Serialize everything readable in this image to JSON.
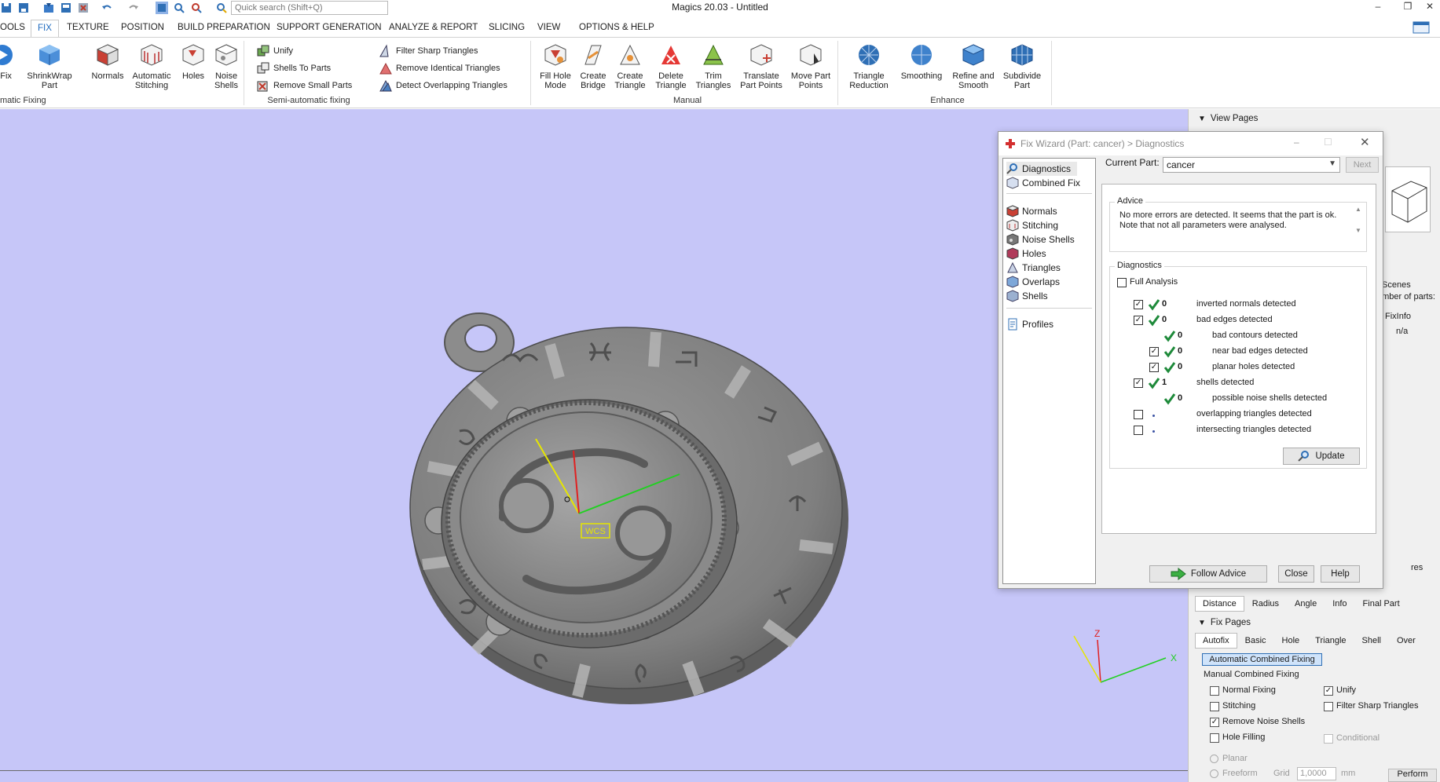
{
  "window": {
    "title": "Magics 20.03 - Untitled",
    "search_placeholder": "Quick search (Shift+Q)",
    "controls": [
      "–",
      "❐",
      "✕"
    ]
  },
  "menu_tabs": [
    "OOLS",
    "FIX",
    "TEXTURE",
    "POSITION",
    "BUILD PREPARATION",
    "SUPPORT GENERATION",
    "ANALYZE & REPORT",
    "SLICING",
    "VIEW",
    "OPTIONS & HELP"
  ],
  "ribbon": {
    "automatic_fixing": {
      "label": "matic Fixing",
      "buttons": [
        "toFix",
        "ShrinkWrap Part",
        "Normals",
        "Automatic Stitching",
        "Holes",
        "Noise Shells"
      ]
    },
    "semi_automatic_fixing": {
      "label": "Semi-automatic fixing",
      "items": [
        "Unify",
        "Shells To Parts",
        "Remove Small Parts",
        "Filter Sharp Triangles",
        "Remove Identical Triangles",
        "Detect Overlapping Triangles"
      ]
    },
    "manual": {
      "label": "Manual",
      "buttons": [
        "Fill Hole Mode",
        "Create Bridge",
        "Create Triangle",
        "Delete Triangle",
        "Trim Triangles",
        "Translate Part Points",
        "Move Part Points"
      ]
    },
    "enhance": {
      "label": "Enhance",
      "buttons": [
        "Triangle Reduction",
        "Smoothing",
        "Refine and Smooth",
        "Subdivide Part"
      ]
    }
  },
  "viewport": {
    "wcs_label": "WCS",
    "axes": {
      "x": "X",
      "y": "Y",
      "z": "Z"
    },
    "background": "#c6c6f8"
  },
  "fix_wizard": {
    "title": "Fix Wizard (Part: cancer) > Diagnostics",
    "nav": {
      "top": [
        "Diagnostics",
        "Combined Fix"
      ],
      "middle": [
        "Normals",
        "Stitching",
        "Noise Shells",
        "Holes",
        "Triangles",
        "Overlaps",
        "Shells"
      ],
      "bottom": [
        "Profiles"
      ]
    },
    "current_part_label": "Current Part:",
    "current_part_value": "cancer",
    "next_label": "Next",
    "advice_title": "Advice",
    "advice_text": "No more errors are detected. It seems that the part is ok. Note that not all parameters were analysed.",
    "diagnostics_title": "Diagnostics",
    "full_analysis_label": "Full Analysis",
    "rows": [
      {
        "label": "inverted normals detected",
        "count": "0"
      },
      {
        "label": "bad edges detected",
        "count": "0"
      },
      {
        "label": "bad contours detected",
        "count": "0"
      },
      {
        "label": "near bad edges detected",
        "count": "0"
      },
      {
        "label": "planar holes detected",
        "count": "0"
      },
      {
        "label": "shells detected",
        "count": "1"
      },
      {
        "label": "possible noise shells detected",
        "count": "0"
      },
      {
        "label": "overlapping triangles detected",
        "count": ""
      },
      {
        "label": "intersecting triangles detected",
        "count": ""
      }
    ],
    "update_label": "Update",
    "follow_advice_label": "Follow Advice",
    "close_label": "Close",
    "help_label": "Help"
  },
  "right_dock": {
    "view_pages_label": "View Pages",
    "scenes_label": "Scenes",
    "number_of_parts_label": "umber of parts:",
    "fixinfo_header": "FixInfo",
    "fixinfo_value": "n/a",
    "res_label": "res",
    "measurement_tabs": [
      "Distance",
      "Radius",
      "Angle",
      "Info",
      "Final Part"
    ],
    "fix_pages_label": "Fix Pages",
    "fix_tabs": [
      "Autofix",
      "Basic",
      "Hole",
      "Triangle",
      "Shell",
      "Over"
    ],
    "auto_combined_label": "Automatic Combined Fixing",
    "manual_combined_label": "Manual Combined Fixing",
    "options": {
      "normal_fixing": "Normal Fixing",
      "unify": "Unify",
      "stitching": "Stitching",
      "filter_sharp": "Filter Sharp Triangles",
      "remove_noise": "Remove Noise Shells",
      "hole_filling": "Hole Filling",
      "conditional": "Conditional",
      "planar": "Planar",
      "freeform": "Freeform",
      "grid_label": "Grid",
      "grid_value": "1,0000",
      "grid_unit": "mm",
      "perform_label": "Perform"
    }
  }
}
